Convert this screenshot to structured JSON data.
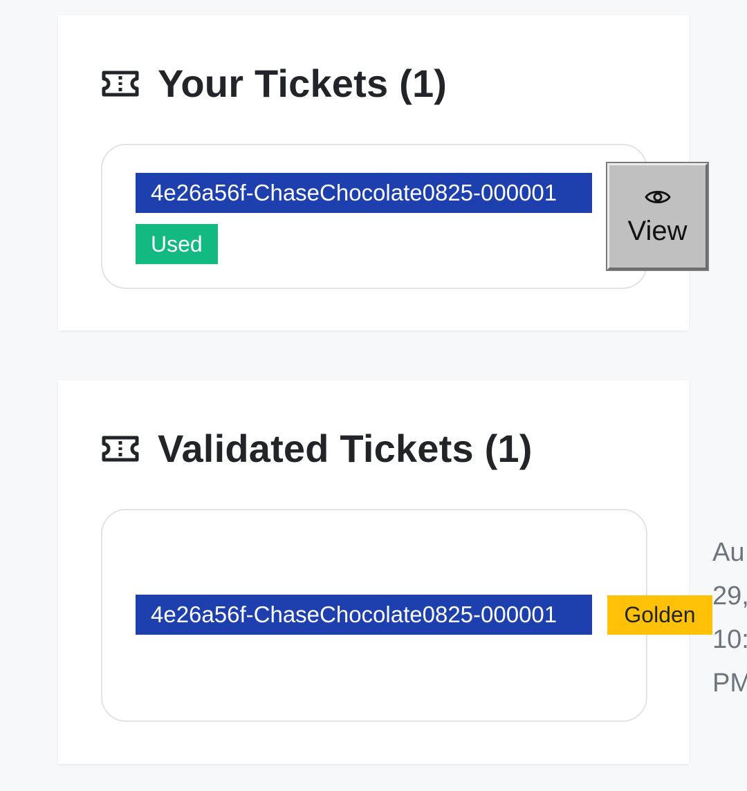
{
  "your_tickets": {
    "title": "Your Tickets (1)",
    "icon": "ticket-icon",
    "items": [
      {
        "code": "4e26a56f-ChaseChocolate0825-000001",
        "status": "Used",
        "view_label": "View"
      }
    ]
  },
  "validated_tickets": {
    "title": "Validated Tickets (1)",
    "icon": "ticket-icon",
    "items": [
      {
        "code": "4e26a56f-ChaseChocolate0825-000001",
        "tier": "Golden",
        "date": "Au\n29,\n10:\nPM"
      }
    ]
  },
  "colors": {
    "code_bg": "#1e3fae",
    "used_bg": "#12b981",
    "golden_bg": "#ffc107",
    "page_bg": "#f7f8fa"
  }
}
